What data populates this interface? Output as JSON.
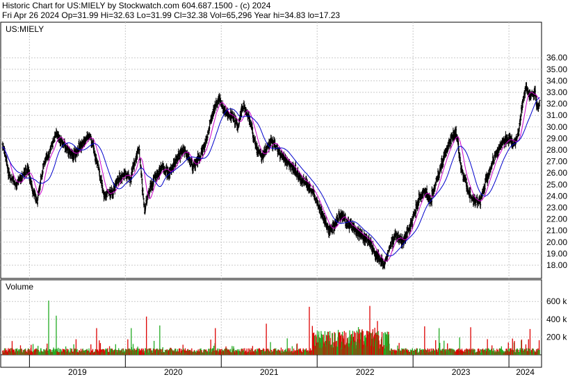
{
  "header": {
    "title_line": "Historic Chart for US:MIELY by Stockwatch.com 604.687.1500 - (c) 2024",
    "stats_line": "Fri Apr 26 2024   Op=31.99  Hi=32.63  Lo=31.99  Cl=32.38  Vol=65,296  Year hi=34.83  lo=17.23"
  },
  "chart_data": [
    {
      "type": "bar",
      "title": "US:MIELY",
      "style": "ohlc daily bars (black) with two moving averages (magenta, blue)",
      "ylim": [
        17.0,
        36.5
      ],
      "y_ticks": [
        "36.00",
        "35.00",
        "34.00",
        "33.00",
        "32.00",
        "31.00",
        "30.00",
        "29.00",
        "28.00",
        "27.00",
        "26.00",
        "25.00",
        "24.00",
        "23.00",
        "22.00",
        "21.00",
        "20.00",
        "19.00",
        "18.00"
      ],
      "x_ticks": [
        "2019",
        "2020",
        "2021",
        "2022",
        "2023",
        "2024"
      ],
      "grid": true,
      "price_path": {
        "t": [
          2018.72,
          2018.78,
          2018.85,
          2018.92,
          2018.98,
          2019.03,
          2019.08,
          2019.14,
          2019.21,
          2019.28,
          2019.35,
          2019.45,
          2019.55,
          2019.62,
          2019.7,
          2019.78,
          2019.87,
          2019.93,
          2020.0,
          2020.05,
          2020.1,
          2020.14,
          2020.17,
          2020.2,
          2020.23,
          2020.3,
          2020.38,
          2020.45,
          2020.55,
          2020.62,
          2020.7,
          2020.78,
          2020.85,
          2020.9,
          2020.97,
          2021.02,
          2021.07,
          2021.12,
          2021.17,
          2021.23,
          2021.3,
          2021.37,
          2021.42,
          2021.5,
          2021.55,
          2021.62,
          2021.68,
          2021.75,
          2021.82,
          2021.9,
          2021.97,
          2022.05,
          2022.12,
          2022.18,
          2022.25,
          2022.32,
          2022.4,
          2022.47,
          2022.55,
          2022.6,
          2022.65,
          2022.7,
          2022.75,
          2022.82,
          2022.9,
          2022.97,
          2023.05,
          2023.12,
          2023.18,
          2023.25,
          2023.3,
          2023.37,
          2023.45,
          2023.5,
          2023.57,
          2023.63,
          2023.7,
          2023.77,
          2023.85,
          2023.92,
          2024.0,
          2024.05,
          2024.1,
          2024.13,
          2024.18,
          2024.22,
          2024.27,
          2024.3,
          2024.32
        ],
        "close": [
          28.5,
          26.0,
          25.0,
          25.5,
          26.5,
          24.5,
          23.5,
          26.5,
          28.0,
          29.5,
          28.5,
          27.5,
          28.5,
          29.5,
          27.0,
          24.0,
          24.5,
          25.5,
          26.0,
          25.5,
          27.0,
          28.0,
          25.5,
          22.5,
          24.0,
          25.5,
          26.5,
          26.0,
          27.5,
          28.0,
          26.5,
          27.5,
          29.0,
          31.0,
          32.5,
          31.5,
          31.0,
          31.0,
          30.0,
          32.0,
          30.5,
          28.0,
          27.5,
          28.5,
          28.5,
          27.5,
          27.0,
          26.5,
          25.5,
          25.0,
          24.0,
          22.5,
          21.0,
          21.5,
          22.5,
          21.5,
          21.0,
          20.5,
          20.0,
          19.0,
          18.5,
          18.0,
          19.5,
          20.5,
          20.0,
          21.5,
          23.5,
          24.5,
          23.5,
          25.5,
          27.0,
          28.5,
          29.5,
          26.5,
          24.5,
          23.5,
          23.5,
          25.5,
          27.5,
          28.5,
          29.0,
          28.5,
          29.5,
          31.5,
          33.5,
          32.5,
          33.0,
          31.5,
          32.38
        ]
      },
      "moving_averages": [
        {
          "color": "#cc00cc"
        },
        {
          "color": "#0000cc"
        }
      ]
    },
    {
      "type": "bar",
      "title": "Volume",
      "ylim": [
        0,
        800
      ],
      "y_ticks": [
        "600 k",
        "400 k",
        "200 k"
      ],
      "x_ticks": [
        "2019",
        "2020",
        "2021",
        "2022",
        "2023",
        "2024"
      ],
      "colors": {
        "up": "#22aa22",
        "down": "#dd0000"
      },
      "spikes": [
        {
          "t": 2019.2,
          "value_k": 610
        },
        {
          "t": 2019.28,
          "value_k": 440
        },
        {
          "t": 2019.7,
          "value_k": 300
        },
        {
          "t": 2020.06,
          "value_k": 300
        },
        {
          "t": 2020.22,
          "value_k": 430
        },
        {
          "t": 2020.36,
          "value_k": 330
        },
        {
          "t": 2020.94,
          "value_k": 300
        },
        {
          "t": 2021.47,
          "value_k": 350
        },
        {
          "t": 2021.92,
          "value_k": 540
        },
        {
          "t": 2022.55,
          "value_k": 550
        },
        {
          "t": 2022.63,
          "value_k": 380
        },
        {
          "t": 2023.12,
          "value_k": 320
        },
        {
          "t": 2023.27,
          "value_k": 300
        },
        {
          "t": 2023.6,
          "value_k": 310
        },
        {
          "t": 2024.22,
          "value_k": 290
        }
      ]
    }
  ]
}
